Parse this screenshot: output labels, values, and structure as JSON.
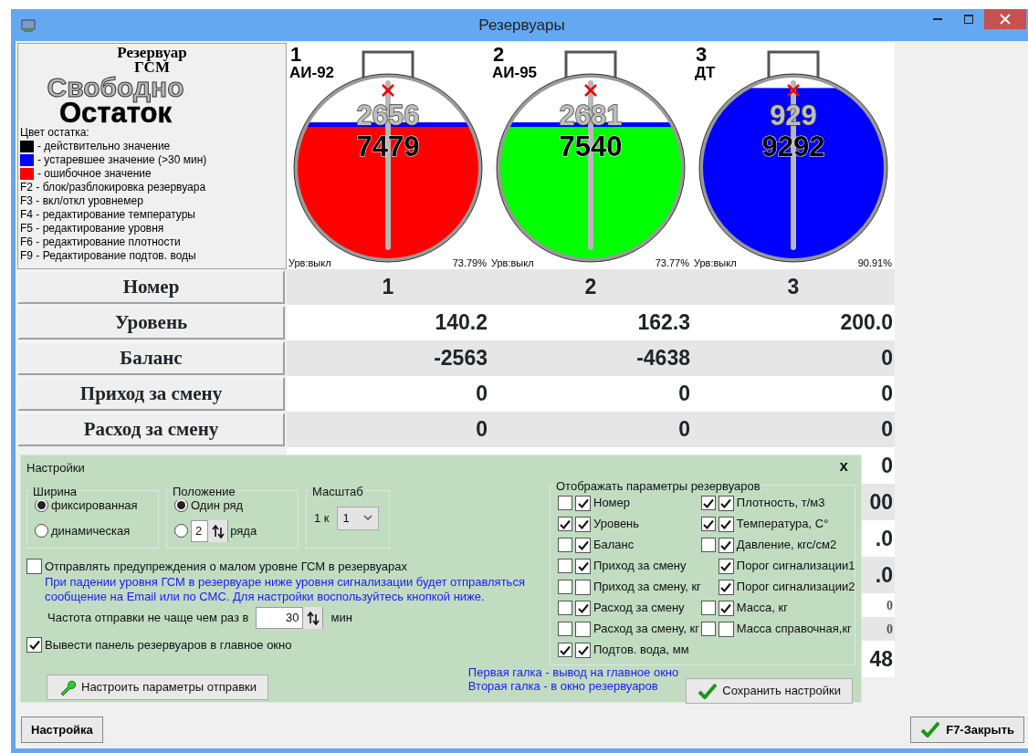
{
  "window": {
    "title": "Резервуары"
  },
  "legend": {
    "title_lines": [
      "Резервуар",
      "ГСМ"
    ],
    "free_label": "Свободно",
    "remain_label": "Остаток",
    "color_caption": "Цвет остатка:",
    "colors": [
      {
        "color": "#000000",
        "text": "- действительно значение"
      },
      {
        "color": "#0000ff",
        "text": "- устаревшее значение (>30 мин)"
      },
      {
        "color": "#ff0000",
        "text": "- ошибочное значение"
      }
    ],
    "hotkeys": [
      "F2 - блок/разблокировка резервуара",
      "F3 - вкл/откл уровнемер",
      "F4 - редактирование температуры",
      "F5 - редактирование уровня",
      "F6 - редактирование плотности",
      "F9 - Редактирование подтов. воды"
    ]
  },
  "tanks": [
    {
      "number": "1",
      "fuel": "АИ-92",
      "free": "2656",
      "remaining": "7479",
      "color": "#ff0000",
      "level": 0.74,
      "gauge": "Урв:выкл",
      "percent": "73.79%"
    },
    {
      "number": "2",
      "fuel": "АИ-95",
      "free": "2681",
      "remaining": "7540",
      "color": "#00ff00",
      "level": 0.74,
      "gauge": "Урв:выкл",
      "percent": "73.77%"
    },
    {
      "number": "3",
      "fuel": "ДТ",
      "free": "929",
      "remaining": "9292",
      "color": "#0000ff",
      "level": 0.92,
      "gauge": "Урв:выкл",
      "percent": "90.91%"
    }
  ],
  "rows": [
    {
      "label": "Номер",
      "kind": "centered",
      "values": [
        "1",
        "2",
        "3"
      ]
    },
    {
      "label": "Уровень",
      "kind": "value",
      "values": [
        "140.2",
        "162.3",
        "200.0"
      ]
    },
    {
      "label": "Баланс",
      "kind": "value",
      "values": [
        "-2563",
        "-4638",
        "0"
      ]
    },
    {
      "label": "Приход за смену",
      "kind": "value",
      "values": [
        "0",
        "0",
        "0"
      ]
    },
    {
      "label": "Расход за смену",
      "kind": "value",
      "values": [
        "0",
        "0",
        "0"
      ]
    }
  ],
  "rows_under_panel": [
    {
      "kind": "large",
      "column_3": "0"
    },
    {
      "kind": "large",
      "column_3": "00"
    },
    {
      "kind": "large",
      "column_3": ".0"
    },
    {
      "kind": "large",
      "column_3": ".0"
    },
    {
      "kind": "small",
      "column_3": "0"
    },
    {
      "kind": "small",
      "column_3": "0"
    },
    {
      "kind": "large",
      "column_3": "48"
    }
  ],
  "settings": {
    "title": "Настройки",
    "close": "x",
    "width": {
      "legend": "Ширина",
      "options": [
        {
          "label": "фиксированная",
          "selected": true
        },
        {
          "label": "динамическая",
          "selected": false
        }
      ]
    },
    "position": {
      "legend": "Положение",
      "options": [
        {
          "label": "Один ряд",
          "selected": true
        },
        {
          "rows_value": "2",
          "label": "ряда",
          "selected": false
        }
      ]
    },
    "scale": {
      "legend": "Масштаб",
      "prefix": "1 к",
      "value": "1"
    },
    "send_warnings": {
      "label": "Отправлять предупреждения о малом уровне ГСМ в резервуарах",
      "checked": false
    },
    "info_lines": [
      "При падении уровня ГСМ в резервуаре ниже уровня сигнализации будет отправляться",
      "сообщение на Email или по СМС. Для настройки воспользуйтесь кнопкой ниже."
    ],
    "frequency": {
      "label": "Частота отправки не чаще чем раз в",
      "value": "30",
      "unit": "мин"
    },
    "show_panel": {
      "label": "Вывести панель резервуаров в главное окно",
      "checked": true
    },
    "configure_button": "Настроить параметры отправки",
    "params": {
      "legend": "Отображать параметры резервуаров",
      "columns": [
        [
          {
            "label": "Номер",
            "main": false,
            "window": true
          },
          {
            "label": "Уровень",
            "main": true,
            "window": true
          },
          {
            "label": "Баланс",
            "main": false,
            "window": true
          },
          {
            "label": "Приход за смену",
            "main": false,
            "window": true
          },
          {
            "label": "Приход за смену, кг",
            "main": false,
            "window": false
          },
          {
            "label": "Расход за смену",
            "main": false,
            "window": true
          },
          {
            "label": "Расход за смену, кг",
            "main": false,
            "window": false
          },
          {
            "label": "Подтов. вода, мм",
            "main": true,
            "window": true
          }
        ],
        [
          {
            "label": "Плотность, т/м3",
            "main": true,
            "window": true
          },
          {
            "label": "Температура, С°",
            "main": true,
            "window": true
          },
          {
            "label": "Давление, кгс/см2",
            "main": false,
            "window": true
          },
          {
            "label": "Порог сигнализации1",
            "window": true
          },
          {
            "label": "Порог сигнализации2",
            "window": true
          },
          {
            "label": "Масса, кг",
            "main": false,
            "window": true
          },
          {
            "label": "Масса справочная,кг",
            "main": false,
            "window": false
          }
        ]
      ]
    },
    "notes": [
      "Первая галка - вывод на главное окно",
      "Вторая галка - в окно резервуаров"
    ],
    "save_button": "Сохранить настройки"
  },
  "footer": {
    "settings_button": "Настройка",
    "close_button": "F7-Закрыть"
  }
}
